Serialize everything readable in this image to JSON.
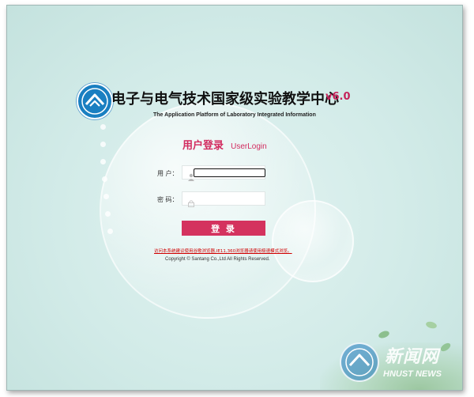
{
  "header": {
    "title": "电子与电气技术国家级实验教学中心",
    "version": "v6.0",
    "subtitle": "The Application Platform of Laboratory Integrated Information"
  },
  "login": {
    "heading": "用户登录",
    "heading_en": "UserLogin",
    "user_label": "用 户：",
    "user_value": "",
    "password_label": "密 码：",
    "password_value": "",
    "submit_label": "登 录"
  },
  "footer": {
    "notice": "访问本系统建议使用谷歌浏览器,IE11,360浏览器请使用极速模式浏览。",
    "copyright": "Copyright © Santang Co.,Ltd All Rights Reserved."
  },
  "watermark": {
    "cn": "新闻网",
    "en": "HNUST NEWS"
  },
  "colors": {
    "accent": "#d4325e",
    "background": "#d2ebe8",
    "notice": "#d00000"
  },
  "icons": {
    "logo": "university-emblem",
    "user": "user-icon",
    "password": "lock-icon"
  }
}
